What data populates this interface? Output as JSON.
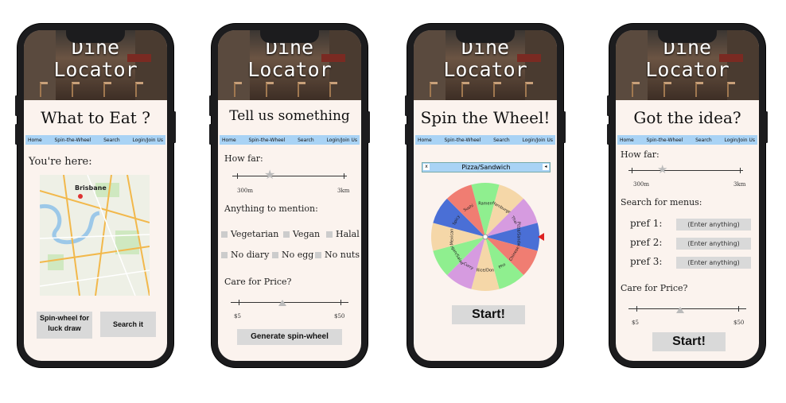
{
  "app_title_line1": "Dine",
  "app_title_line2": "Locator",
  "nav": [
    "Home",
    "Spin-the-Wheel",
    "Search",
    "Login/Join Us"
  ],
  "screen1": {
    "heading": "What to Eat ?",
    "you_here": "You're here:",
    "map_label": "Brisbane",
    "btn_spin": "Spin-wheel for luck draw",
    "btn_search": "Search it"
  },
  "screen2": {
    "heading": "Tell us something",
    "how_far": "How far:",
    "dist_min": "300m",
    "dist_max": "3km",
    "mention": "Anything to mention:",
    "options": [
      "Vegetarian",
      "Vegan",
      "Halal",
      "No diary",
      "No egg",
      "No nuts"
    ],
    "price": "Care for Price?",
    "price_min": "$5",
    "price_max": "$50",
    "btn": "Generate spin-wheel"
  },
  "screen3": {
    "heading": "Spin the Wheel!",
    "wheel_title": "Pizza/Sandwich",
    "wheel_close": "x",
    "slices": [
      "Ramen",
      "Hamburger",
      "Thai",
      "Pizza/Sandwich",
      "Chinese",
      "Pho",
      "Rice/Don",
      "Curry",
      "Vegan/Salad",
      "Mexican",
      "Spicy",
      "Sushi"
    ],
    "slice_colors": [
      "#8fef8f",
      "#f5d7a8",
      "#d69be0",
      "#4a6fd6",
      "#f07d72",
      "#8fef8f",
      "#f5d7a8",
      "#d69be0",
      "#8fef8f",
      "#f5d7a8",
      "#4a6fd6",
      "#f07d72"
    ],
    "btn": "Start!"
  },
  "screen4": {
    "heading": "Got the idea?",
    "how_far": "How far:",
    "dist_min": "300m",
    "dist_max": "3km",
    "menus": "Search for menus:",
    "pref1": "pref 1:",
    "pref2": "pref 2:",
    "pref3": "pref 3:",
    "placeholder": "(Enter anything)",
    "price": "Care for Price?",
    "price_min": "$5",
    "price_max": "$50",
    "btn": "Start!"
  }
}
